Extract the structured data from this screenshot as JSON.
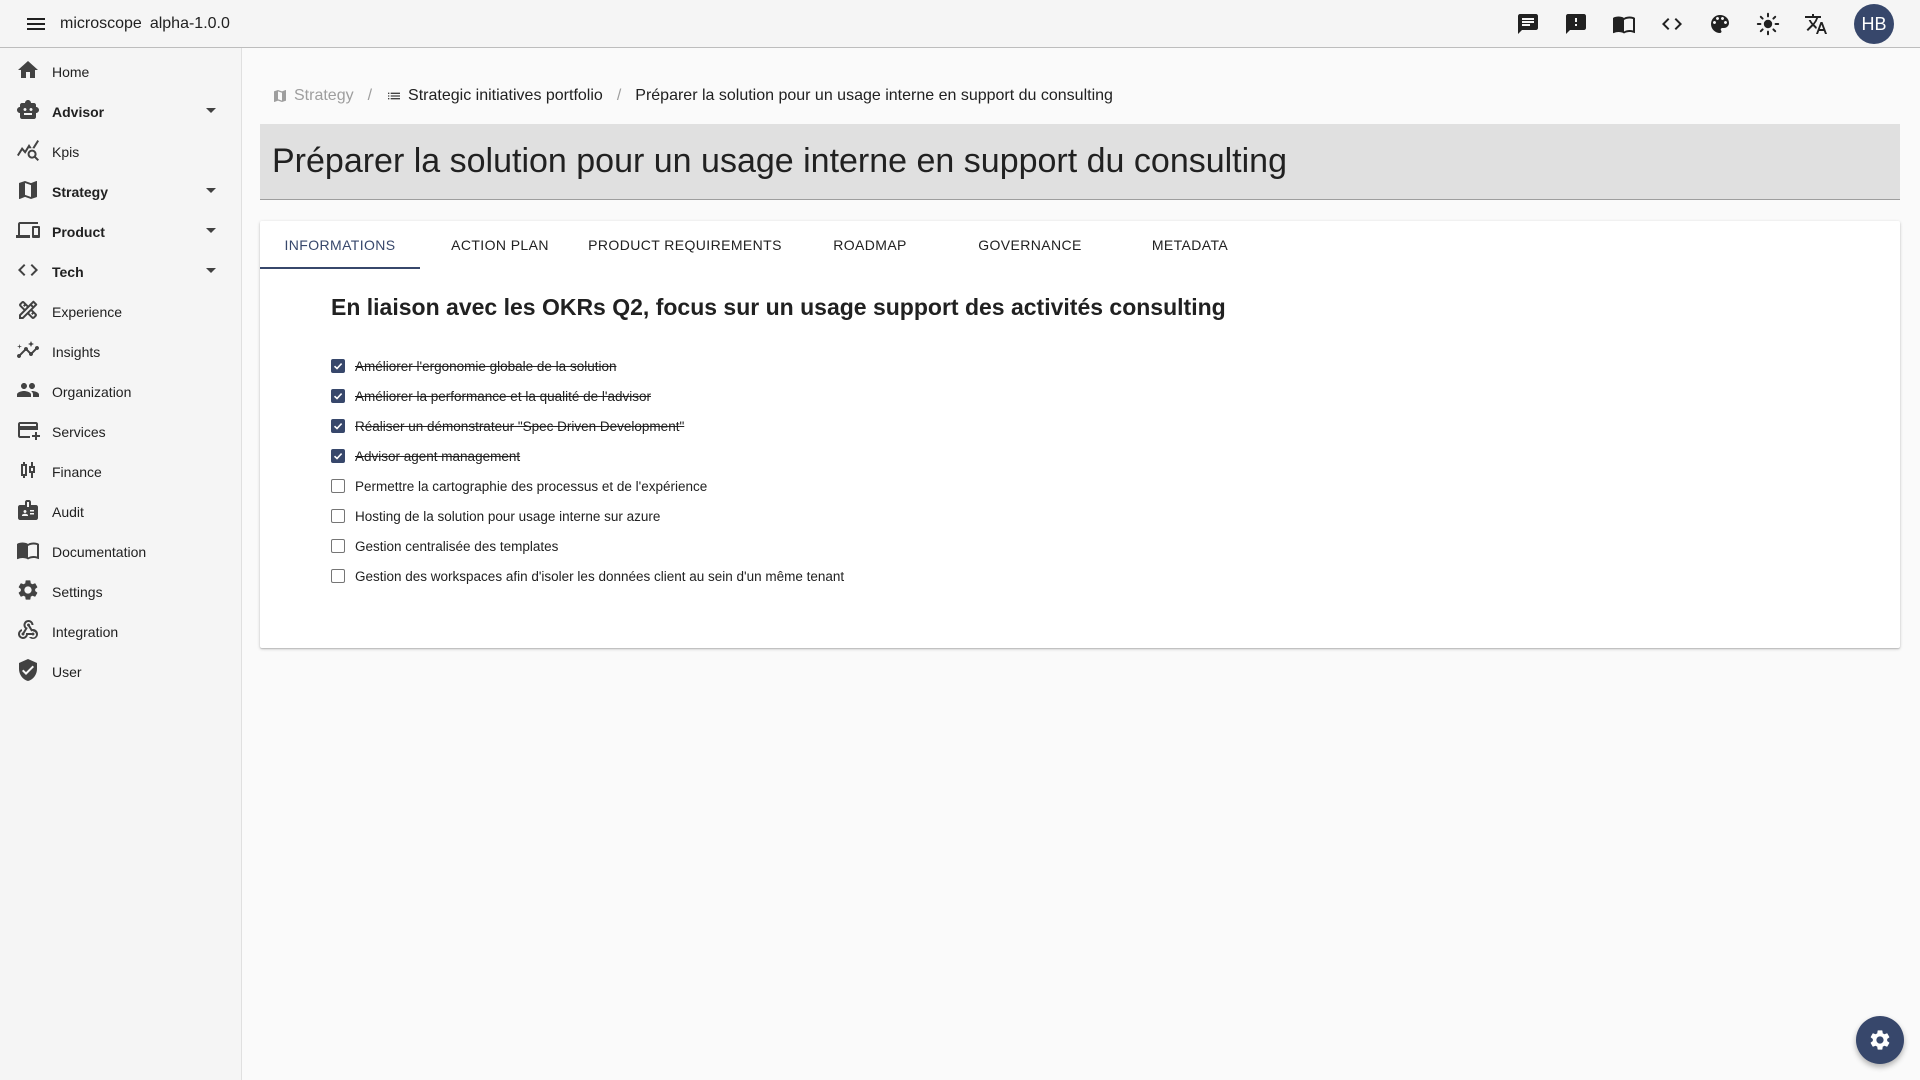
{
  "header": {
    "app_name": "microscope",
    "version": "alpha-1.0.0",
    "action_icons": [
      "chat-icon",
      "feedback-icon",
      "docs-book-icon",
      "code-icon",
      "palette-icon",
      "brightness-icon",
      "translate-icon"
    ],
    "avatar_initials": "HB"
  },
  "sidebar": {
    "items": [
      {
        "label": "Home",
        "icon": "home-icon",
        "expandable": false
      },
      {
        "label": "Advisor",
        "icon": "robot-icon",
        "expandable": true
      },
      {
        "label": "Kpis",
        "icon": "query-stats-icon",
        "expandable": false
      },
      {
        "label": "Strategy",
        "icon": "map-icon",
        "expandable": true
      },
      {
        "label": "Product",
        "icon": "devices-icon",
        "expandable": true
      },
      {
        "label": "Tech",
        "icon": "code-icon",
        "expandable": true
      },
      {
        "label": "Experience",
        "icon": "design-tools-icon",
        "expandable": false
      },
      {
        "label": "Insights",
        "icon": "insights-icon",
        "expandable": false
      },
      {
        "label": "Organization",
        "icon": "people-icon",
        "expandable": false
      },
      {
        "label": "Services",
        "icon": "services-card-icon",
        "expandable": false
      },
      {
        "label": "Finance",
        "icon": "candlestick-icon",
        "expandable": false
      },
      {
        "label": "Audit",
        "icon": "audit-badge-icon",
        "expandable": false
      },
      {
        "label": "Documentation",
        "icon": "menu-book-icon",
        "expandable": false
      },
      {
        "label": "Settings",
        "icon": "gear-icon",
        "expandable": false
      },
      {
        "label": "Integration",
        "icon": "webhook-icon",
        "expandable": false
      },
      {
        "label": "User",
        "icon": "shield-check-icon",
        "expandable": false
      }
    ]
  },
  "breadcrumb": {
    "items": [
      {
        "label": "Strategy",
        "icon": "map-icon"
      },
      {
        "label": "Strategic initiatives portfolio",
        "icon": "list-icon"
      },
      {
        "label": "Préparer la solution pour un usage interne en support du consulting"
      }
    ],
    "separator": "/"
  },
  "page": {
    "title": "Préparer la solution pour un usage interne en support du consulting"
  },
  "tabs": [
    {
      "label": "INFORMATIONS",
      "active": true
    },
    {
      "label": "ACTION PLAN",
      "active": false
    },
    {
      "label": "PRODUCT REQUIREMENTS",
      "active": false
    },
    {
      "label": "ROADMAP",
      "active": false
    },
    {
      "label": "GOVERNANCE",
      "active": false
    },
    {
      "label": "METADATA",
      "active": false
    }
  ],
  "content": {
    "heading": "En liaison avec les OKRs Q2, focus sur un usage support des activités consulting",
    "tasks": [
      {
        "label": "Améliorer l'ergonomie globale de la solution",
        "checked": true
      },
      {
        "label": "Améliorer la performance et la qualité de l'advisor",
        "checked": true
      },
      {
        "label": "Réaliser un démonstrateur \"Spec Driven Development\"",
        "checked": true
      },
      {
        "label": "Advisor agent management",
        "checked": true
      },
      {
        "label": "Permettre la cartographie des processus et de l'expérience",
        "checked": false
      },
      {
        "label": "Hosting de la solution pour usage interne sur azure",
        "checked": false
      },
      {
        "label": "Gestion centralisée des templates",
        "checked": false
      },
      {
        "label": "Gestion des workspaces afin d'isoler les données client au sein d'un même tenant",
        "checked": false
      }
    ]
  },
  "fab": {
    "icon": "gear-icon"
  },
  "colors": {
    "accent": "#37476b",
    "appbar_bg": "#f5f5f5",
    "title_box_bg": "#e0e0e0",
    "page_bg": "#fafafa"
  }
}
